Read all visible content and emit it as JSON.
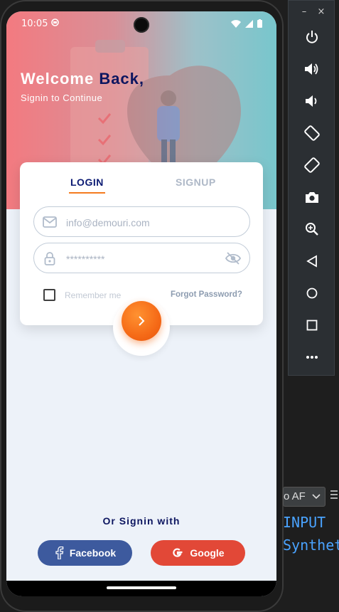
{
  "status_bar": {
    "time": "10:05"
  },
  "header": {
    "welcome_prefix": "Welcome ",
    "welcome_accent": "Back,",
    "subtitle": "Signin to Continue"
  },
  "tabs": {
    "login": "LOGIN",
    "signup": "SIGNUP",
    "active": "login"
  },
  "form": {
    "email_placeholder": "info@demouri.com",
    "password_placeholder": "**********",
    "remember_label": "Remember me",
    "forgot_label": "Forgot Password?"
  },
  "social": {
    "heading": "Or Signin with",
    "facebook_label": "Facebook",
    "google_label": "Google"
  },
  "colors": {
    "accent": "#f47b1f",
    "brand_navy": "#0d1660",
    "facebook": "#3d5a9e",
    "google": "#e24837",
    "background": "#edf2f9"
  },
  "emulator": {
    "window_controls": [
      "–",
      "×"
    ],
    "buttons": [
      "power-icon",
      "volume-up-icon",
      "volume-down-icon",
      "rotate-left-icon",
      "rotate-right-icon",
      "camera-icon",
      "zoom-icon",
      "back-icon",
      "home-icon",
      "overview-icon",
      "more-icon"
    ]
  },
  "ide": {
    "dropdown_text": "o AF",
    "line1": "INPUT",
    "line2": "Synthet"
  }
}
